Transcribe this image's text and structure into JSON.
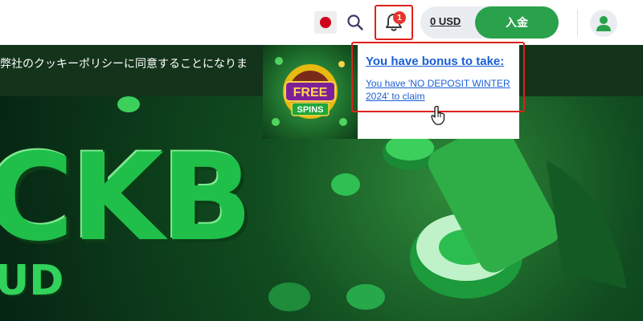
{
  "header": {
    "balance": "0 USD",
    "deposit_label": "入金",
    "notification_count": "1"
  },
  "cookie": {
    "text": "弊社のクッキーポリシーに同意することになりま"
  },
  "hero": {
    "big_text": "CKB",
    "sub_text": "UD"
  },
  "notification": {
    "thumb_title": "FREE",
    "thumb_sub": "SPINS",
    "title": "You have bonus to take:",
    "message": "You have 'NO DEPOSIT WINTER 2024' to claim"
  },
  "colors": {
    "accent_green": "#2aa14b",
    "link_blue": "#1a5fd6",
    "highlight_red": "#e0201b"
  },
  "icons": [
    "japan-flag-icon",
    "search-icon",
    "bell-icon",
    "user-icon",
    "pointer-cursor-icon"
  ]
}
